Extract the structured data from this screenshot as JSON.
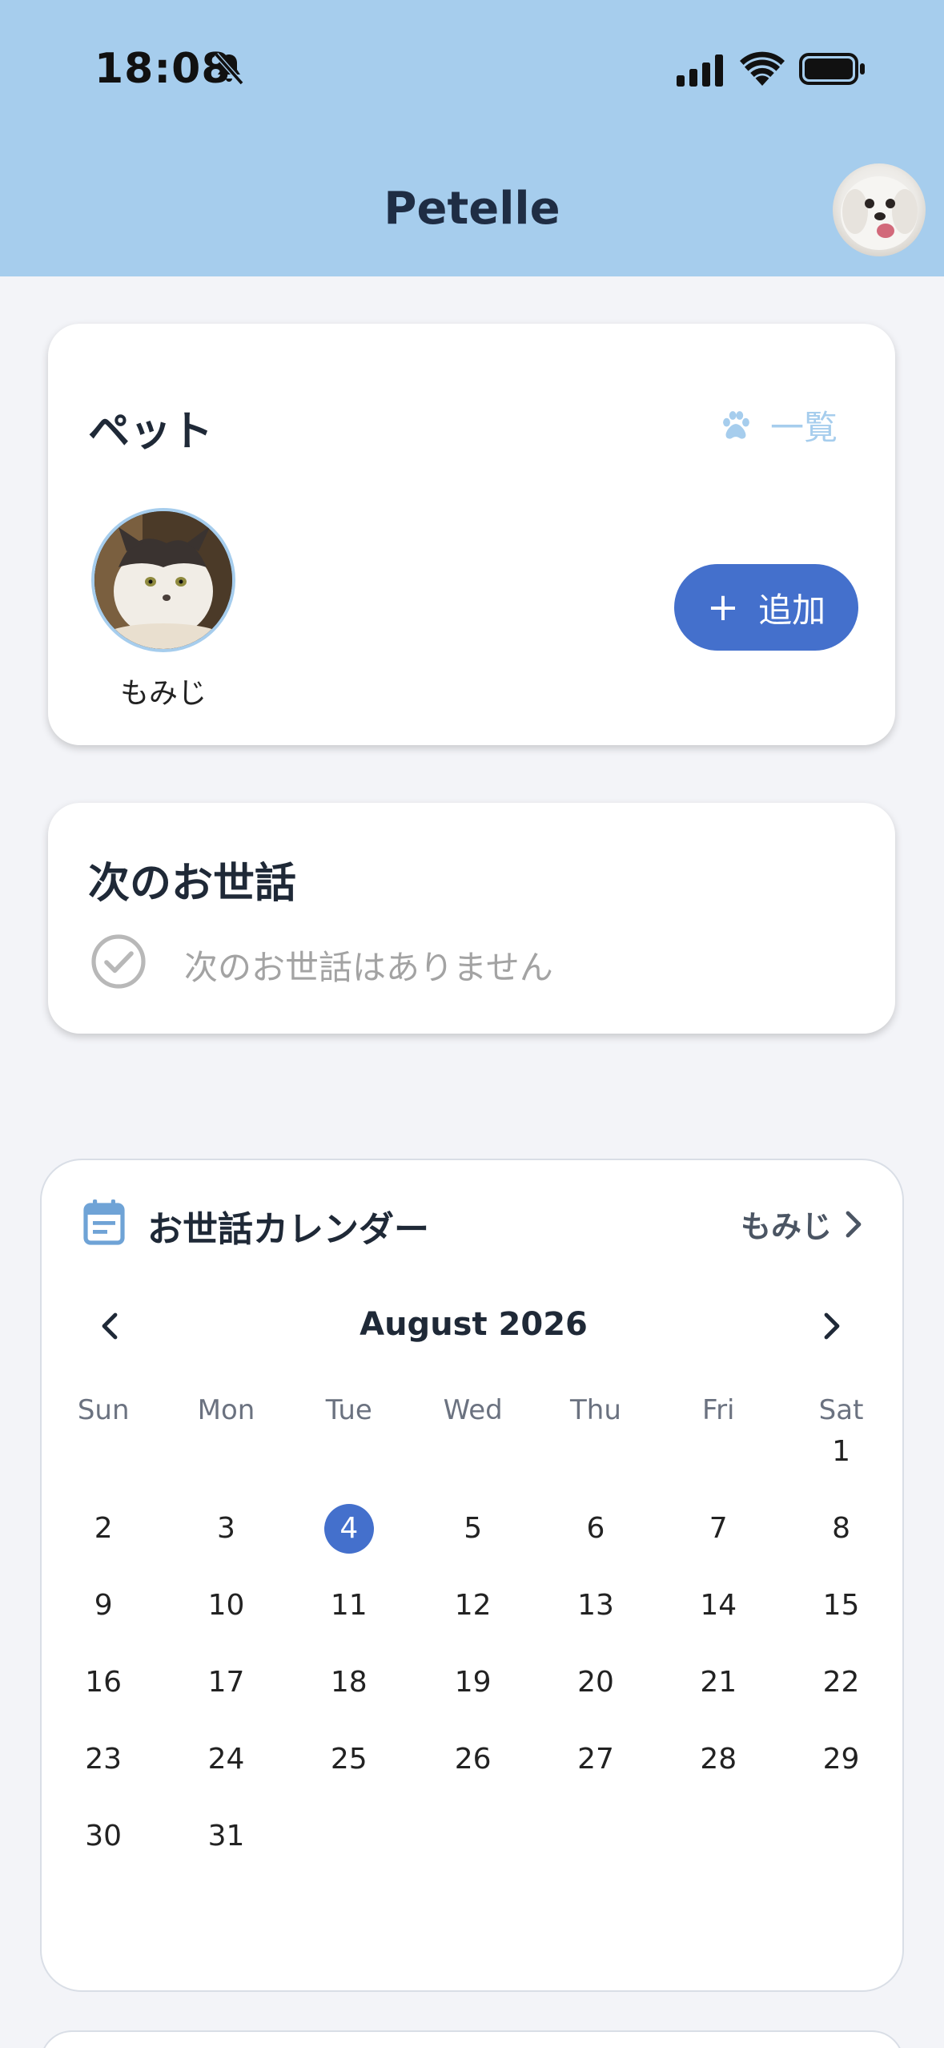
{
  "status_bar": {
    "time": "18:08"
  },
  "header": {
    "title": "Petelle"
  },
  "pets_card": {
    "title": "ペット",
    "list_link": "一覧",
    "pets": [
      {
        "name": "もみじ"
      }
    ],
    "add_button": {
      "plus": "+",
      "label": "追加"
    }
  },
  "next_care_card": {
    "title": "次のお世話",
    "empty_message": "次のお世話はありません"
  },
  "calendar_card": {
    "title": "お世話カレンダー",
    "pet_selector": "もみじ",
    "month_label": "August 2026",
    "weekdays": [
      "Sun",
      "Mon",
      "Tue",
      "Wed",
      "Thu",
      "Fri",
      "Sat"
    ],
    "first_weekday_index": 6,
    "days_in_month": 31,
    "today": 4
  },
  "colors": {
    "header_bg": "#a6cded",
    "accent": "#4470cc",
    "page_bg": "#f3f4f8"
  },
  "icons": [
    "bell-off-icon",
    "signal-icon",
    "wifi-icon",
    "battery-icon",
    "paw-icon",
    "check-circle-icon",
    "calendar-icon",
    "chevron-left-icon",
    "chevron-right-icon"
  ]
}
